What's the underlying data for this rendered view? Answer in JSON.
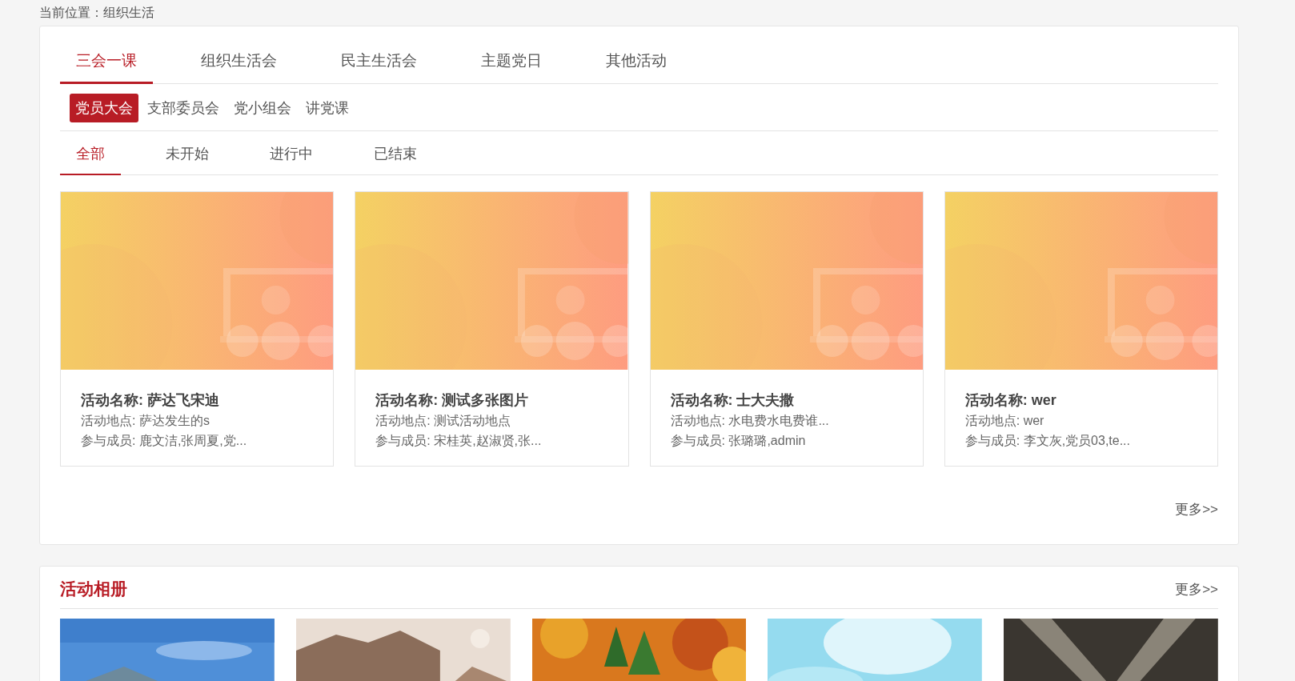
{
  "breadcrumb": "当前位置：组织生活",
  "main_tabs": [
    {
      "label": "三会一课",
      "selected": true
    },
    {
      "label": "组织生活会",
      "selected": false
    },
    {
      "label": "民主生活会",
      "selected": false
    },
    {
      "label": "主题党日",
      "selected": false
    },
    {
      "label": "其他活动",
      "selected": false
    }
  ],
  "sub_tabs": [
    {
      "label": "党员大会",
      "selected": true
    },
    {
      "label": "支部委员会",
      "selected": false
    },
    {
      "label": "党小组会",
      "selected": false
    },
    {
      "label": "讲党课",
      "selected": false
    }
  ],
  "status_tabs": [
    {
      "label": "全部",
      "selected": true
    },
    {
      "label": "未开始",
      "selected": false
    },
    {
      "label": "进行中",
      "selected": false
    },
    {
      "label": "已结束",
      "selected": false
    }
  ],
  "cards": [
    {
      "kind": "picture",
      "name": "活动名称: 萨达飞宋迪",
      "place": "活动地点: 萨达发生的s",
      "members": "参与成员: 鹿文洁,张周夏,党..."
    },
    {
      "kind": "picture",
      "name": "活动名称: 测试多张图片",
      "place": "活动地点: 测试活动地点",
      "members": "参与成员: 宋桂英,赵淑贤,张..."
    },
    {
      "kind": "picture",
      "name": "活动名称: 士大夫撒",
      "place": "活动地点: 水电费水电费谁...",
      "members": "参与成员: 张璐璐,admin"
    },
    {
      "kind": "picture",
      "name": "活动名称: wer",
      "place": "活动地点: wer",
      "members": "参与成员: 李文灰,党员03,te..."
    }
  ],
  "more": "更多>>",
  "album": {
    "title": "活动相册",
    "more": "更多>>"
  }
}
